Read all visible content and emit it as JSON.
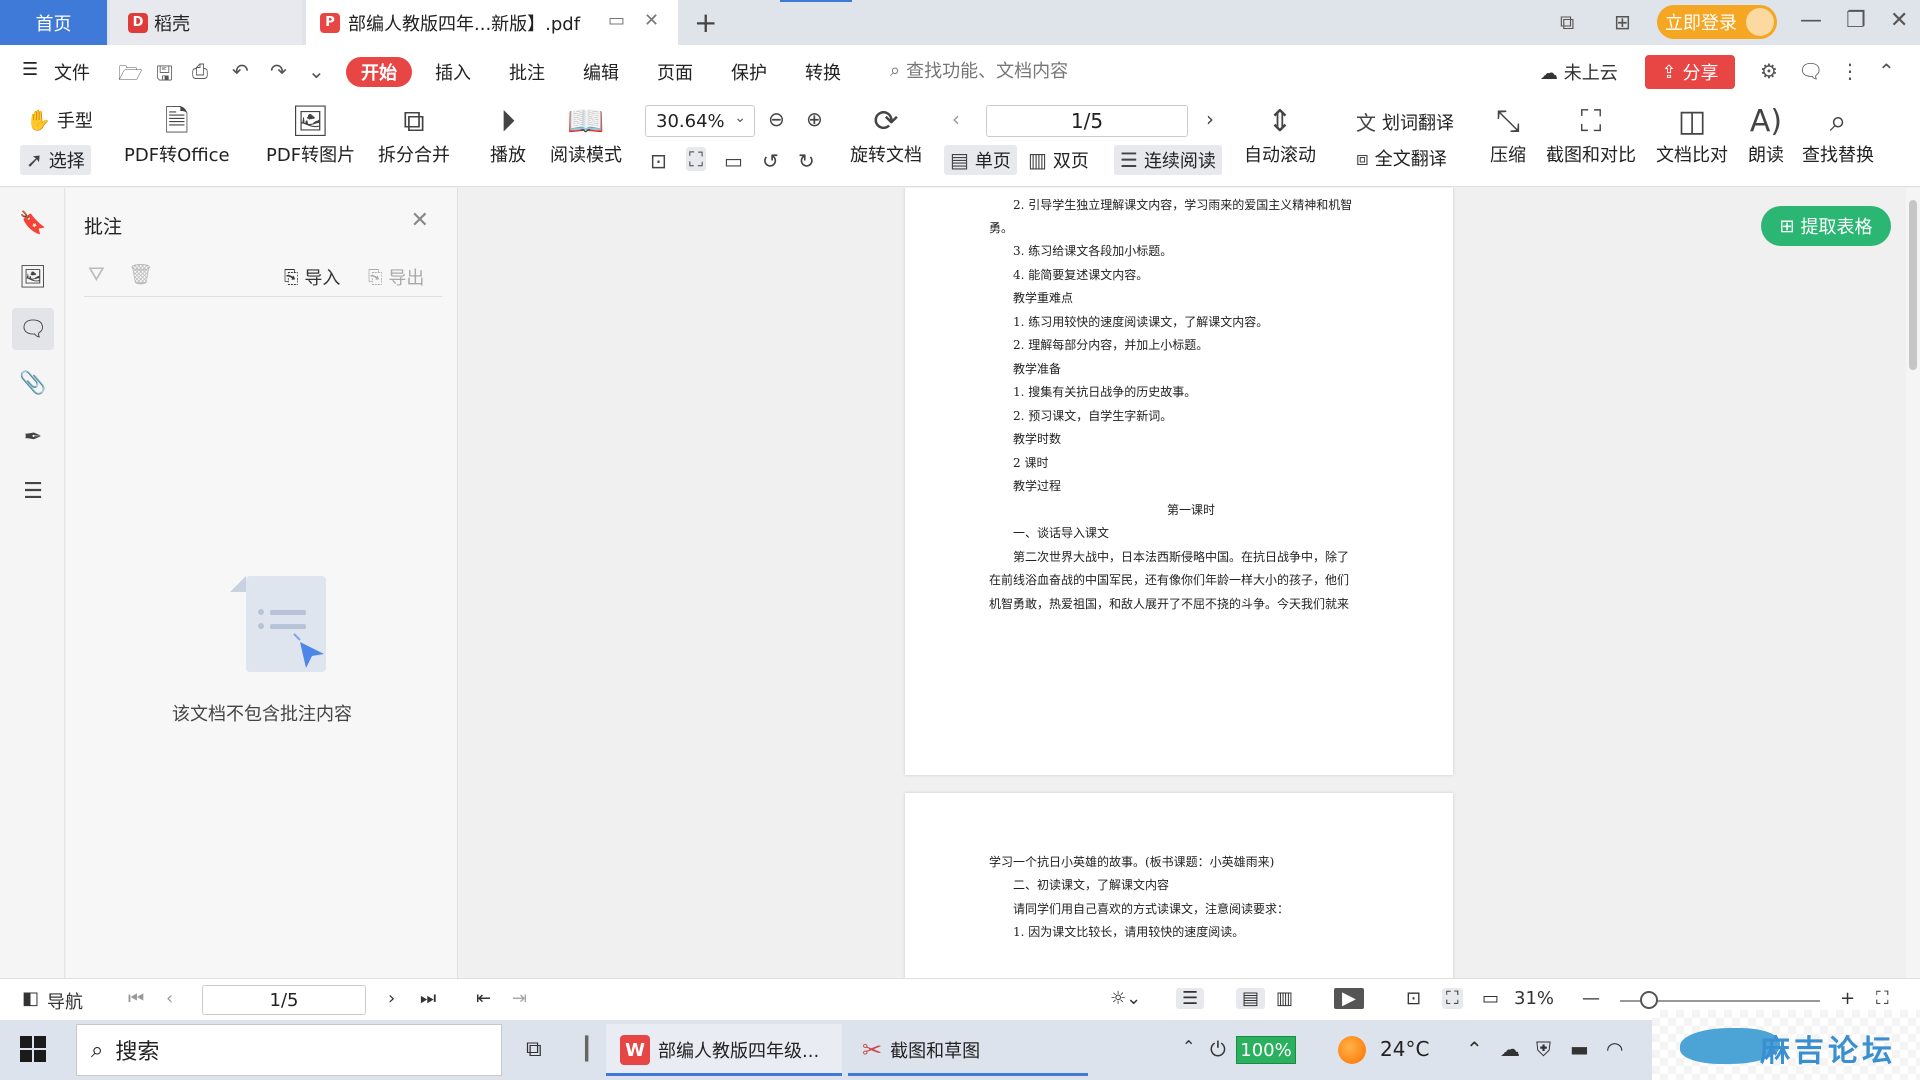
{
  "tabs": {
    "home": "首页",
    "daoke": "稻壳",
    "pdf": "部编人教版四年...新版】.pdf"
  },
  "header_right": {
    "login": "立即登录"
  },
  "menu": {
    "file": "文件",
    "start": "开始",
    "items": [
      "插入",
      "批注",
      "编辑",
      "页面",
      "保护",
      "转换"
    ],
    "search": "查找功能、文档内容",
    "cloud": "未上云",
    "share": "分享"
  },
  "ribbon": {
    "hand": "手型",
    "select": "选择",
    "pdf_to_office": "PDF转Office",
    "pdf_to_image": "PDF转图片",
    "split_merge": "拆分合并",
    "play": "播放",
    "read_mode": "阅读模式",
    "zoom": "30.64%",
    "rotate_doc": "旋转文档",
    "page": "1/5",
    "single": "单页",
    "double": "双页",
    "continuous": "连续阅读",
    "auto_scroll": "自动滚动",
    "word_translate": "划词翻译",
    "full_translate": "全文翻译",
    "compress": "压缩",
    "screenshot_compare": "截图和对比",
    "doc_compare": "文档比对",
    "read_aloud": "朗读",
    "find_replace": "查找替换"
  },
  "annot_panel": {
    "title": "批注",
    "import": "导入",
    "export": "导出",
    "empty": "该文档不包含批注内容"
  },
  "doc": {
    "extract_table": "提取表格",
    "page1_lines": [
      "2. 引导学生独立理解课文内容，学习雨来的爱国主义精神和机智",
      "勇。",
      "3. 练习给课文各段加小标题。",
      "4. 能简要复述课文内容。",
      "教学重难点",
      "1. 练习用较快的速度阅读课文，了解课文内容。",
      "2. 理解每部分内容，并加上小标题。",
      "教学准备",
      "1. 搜集有关抗日战争的历史故事。",
      "2. 预习课文，自学生字新词。",
      "教学时数",
      "2 课时",
      "教学过程",
      "第一课时",
      "一、谈话导入课文",
      "第二次世界大战中，日本法西斯侵略中国。在抗日战争中，除了",
      "在前线浴血奋战的中国军民，还有像你们年龄一样大小的孩子，他们",
      "机智勇敢，热爱祖国，和敌人展开了不屈不挠的斗争。今天我们就来"
    ],
    "page2_lines": [
      "学习一个抗日小英雄的故事。(板书课题：小英雄雨来)",
      "二、初读课文，了解课文内容",
      "请同学们用自己喜欢的方式读课文，注意阅读要求：",
      "1. 因为课文比较长，请用较快的速度阅读。"
    ]
  },
  "statusbar": {
    "nav": "导航",
    "page": "1/5",
    "zoom": "31%"
  },
  "taskbar": {
    "search": "搜索",
    "app1": "部编人教版四年级...",
    "app2": "截图和草图",
    "battery": "100%",
    "temp": "24°C",
    "forum": "麻吉论坛"
  }
}
